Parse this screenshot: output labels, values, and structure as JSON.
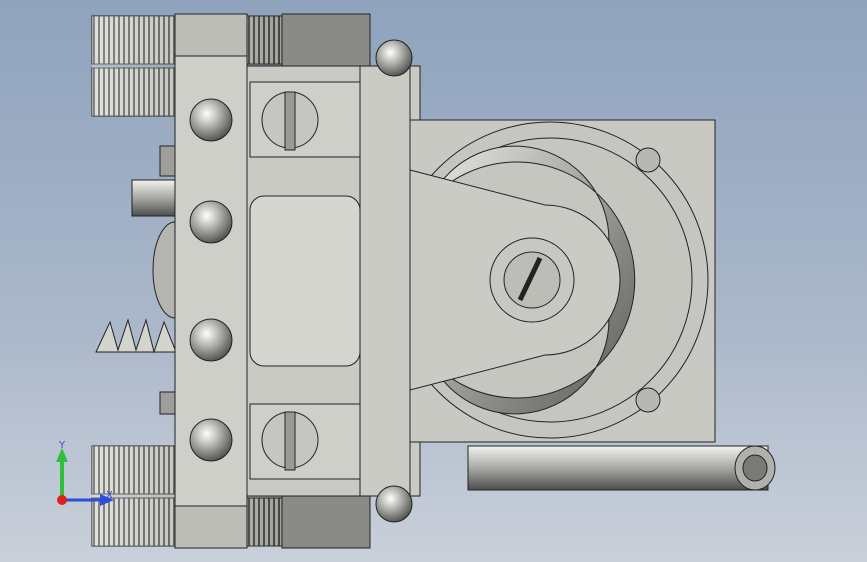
{
  "viewport": {
    "background_top": "#8fa3bd",
    "background_bottom": "#c9d0da"
  },
  "model": {
    "body_color": "#c9c9c3",
    "edge_color": "#2a2a2a",
    "shadow_color": "#7a7a78"
  },
  "triad": {
    "y_label": "Y",
    "x_label": "X",
    "y_color": "#2fbf3a",
    "x_color": "#2c4fd6",
    "origin_color": "#e0201a"
  }
}
